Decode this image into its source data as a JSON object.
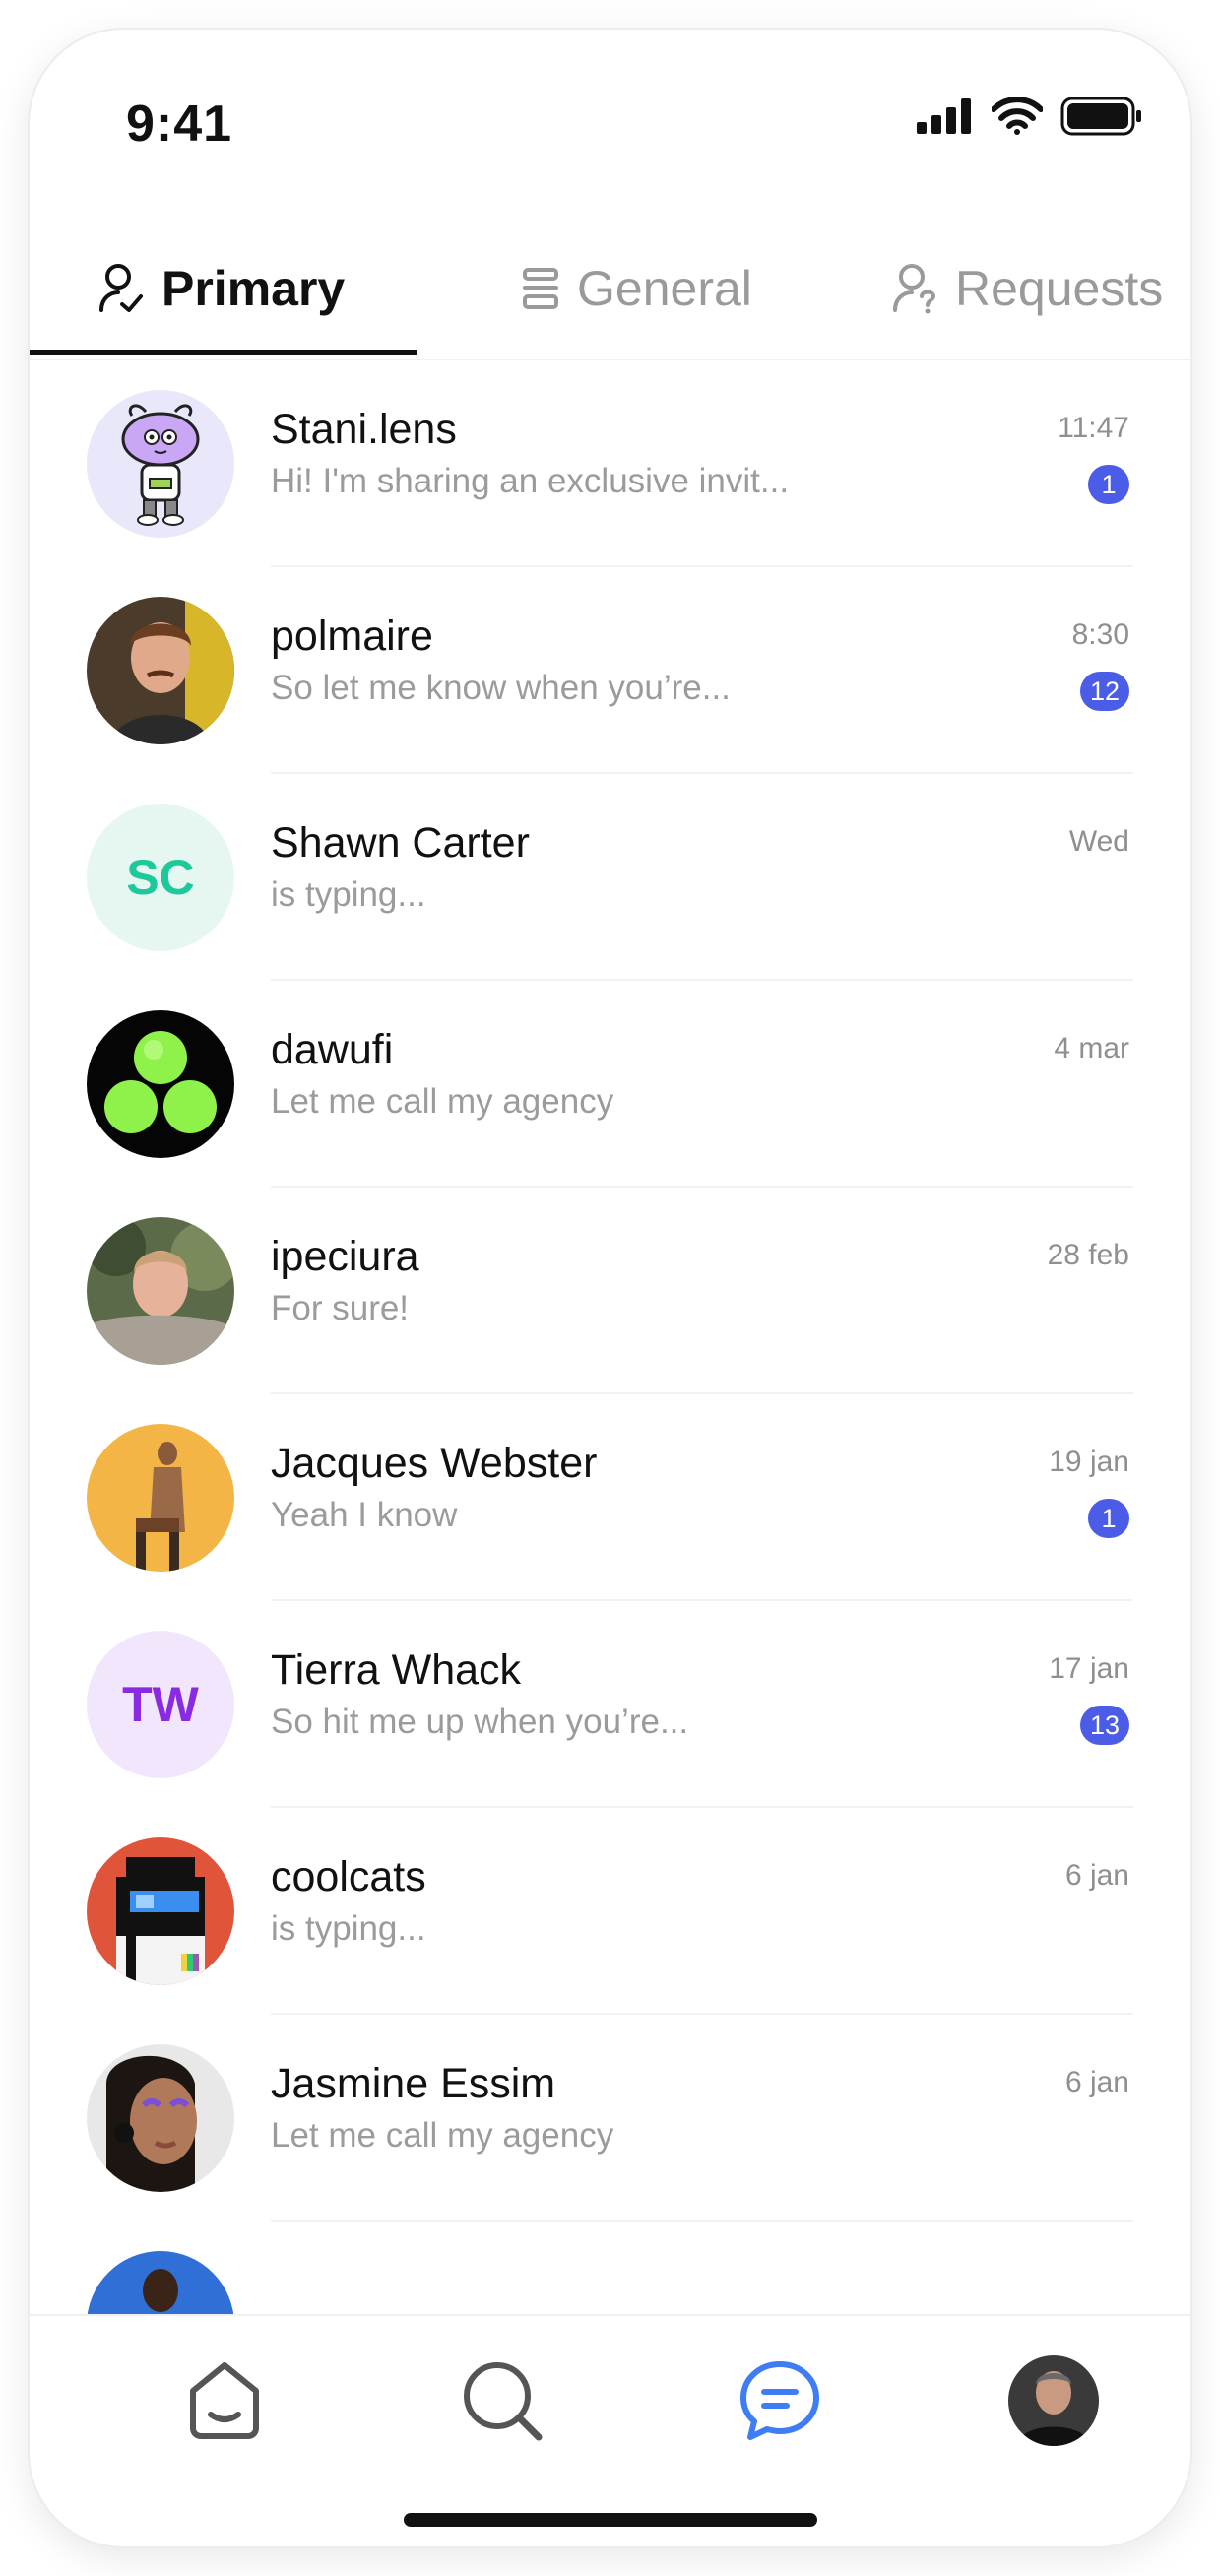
{
  "status_bar": {
    "time": "9:41"
  },
  "tabs": [
    {
      "label": "Primary",
      "icon": "user-check-icon",
      "active": true
    },
    {
      "label": "General",
      "icon": "layers-icon",
      "active": false
    },
    {
      "label": "Requests",
      "icon": "user-question-icon",
      "active": false
    }
  ],
  "chats": [
    {
      "name": "Stani.lens",
      "preview": "Hi! I'm sharing an exclusive invit...",
      "time": "11:47",
      "badge": "1",
      "avatar_type": "cartoon"
    },
    {
      "name": "polmaire",
      "preview": "So let me know when you’re...",
      "time": "8:30",
      "badge": "12",
      "avatar_type": "photo"
    },
    {
      "name": "Shawn Carter",
      "preview": "is typing...",
      "time": "Wed",
      "initials": "SC",
      "avatar_type": "initials",
      "avatar_bg": "#e6f7f1",
      "avatar_fg": "#1dc99a"
    },
    {
      "name": "dawufi",
      "preview": "Let me call my agency",
      "time": "4 mar",
      "avatar_type": "logo"
    },
    {
      "name": "ipeciura",
      "preview": "For sure!",
      "time": "28 feb",
      "avatar_type": "photo"
    },
    {
      "name": "Jacques Webster",
      "preview": "Yeah I know",
      "time": "19 jan",
      "badge": "1",
      "avatar_type": "photo"
    },
    {
      "name": "Tierra Whack",
      "preview": "So hit me up when you’re...",
      "time": "17 jan",
      "badge": "13",
      "initials": "TW",
      "avatar_type": "initials",
      "avatar_bg": "#f1e6fb",
      "avatar_fg": "#8a2be2"
    },
    {
      "name": "coolcats",
      "preview": "is typing...",
      "time": "6 jan",
      "avatar_type": "pixel"
    },
    {
      "name": "Jasmine Essim",
      "preview": "Let me call my agency",
      "time": "6 jan",
      "avatar_type": "photo"
    },
    {
      "name": "",
      "preview": "",
      "time": "",
      "avatar_type": "photo"
    }
  ],
  "bottom_nav": [
    {
      "icon": "home-icon",
      "active": false
    },
    {
      "icon": "search-icon",
      "active": false
    },
    {
      "icon": "messages-icon",
      "active": true
    },
    {
      "icon": "profile-avatar",
      "active": false
    }
  ],
  "colors": {
    "accent": "#4b5ce6",
    "active_nav": "#3f7df4",
    "text_primary": "#111111",
    "text_secondary": "#9b9b9b"
  }
}
